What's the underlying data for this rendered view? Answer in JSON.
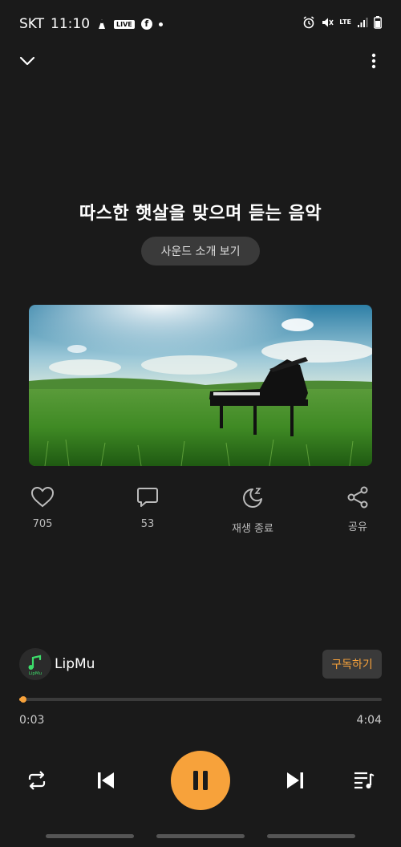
{
  "status_bar": {
    "carrier": "SKT",
    "time": "11:10",
    "live_badge": "LIVE",
    "facebook_badge": "f",
    "network": "LTE"
  },
  "player": {
    "title": "따스한 햇살을 맞으며 듣는 음악",
    "intro_button": "사운드 소개 보기"
  },
  "actions": {
    "like": {
      "icon": "heart-icon",
      "label": "705"
    },
    "comment": {
      "icon": "comment-icon",
      "label": "53"
    },
    "sleep": {
      "icon": "sleep-timer-icon",
      "label": "재생 종료"
    },
    "share": {
      "icon": "share-icon",
      "label": "공유"
    }
  },
  "channel": {
    "name": "LipMu",
    "avatar_text": "LipMu",
    "subscribe_label": "구독하기"
  },
  "progress": {
    "current": "0:03",
    "total": "4:04",
    "fraction": 0.012
  },
  "colors": {
    "accent": "#f7a23b",
    "background": "#1a1a1a"
  }
}
